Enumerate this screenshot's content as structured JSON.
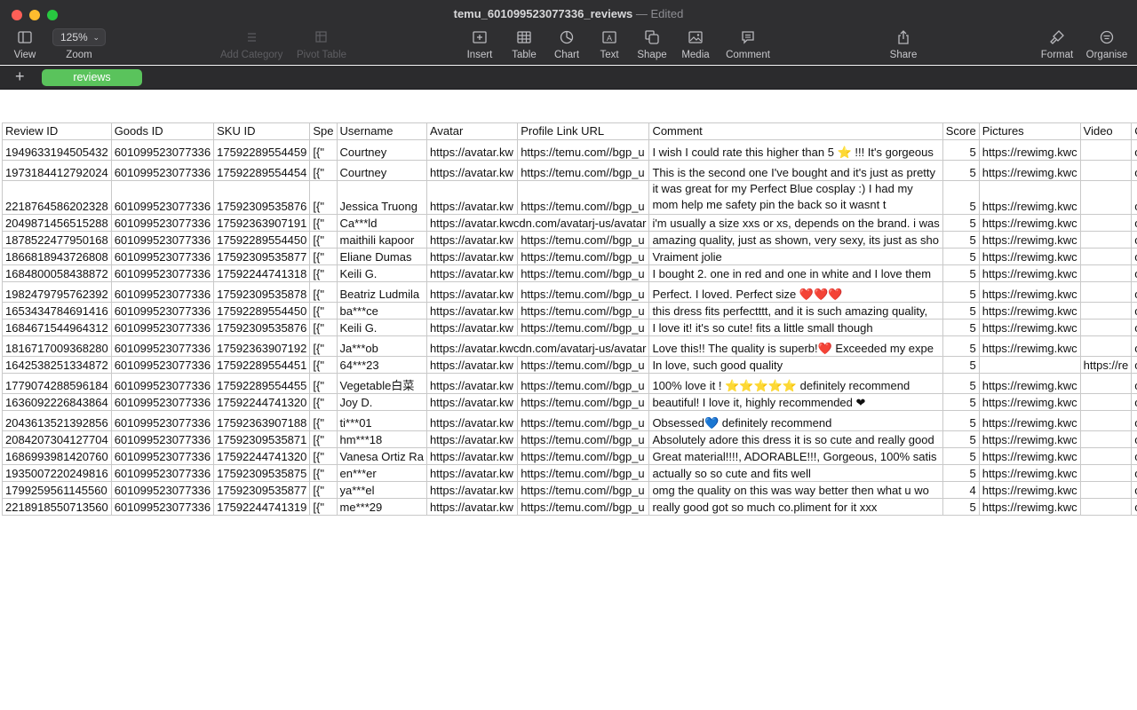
{
  "window": {
    "filename": "temu_601099523077336_reviews",
    "separator": " — ",
    "status": "Edited"
  },
  "toolbar": {
    "view": "View",
    "zoom_value": "125%",
    "zoom": "Zoom",
    "add_category": "Add Category",
    "pivot_table": "Pivot Table",
    "insert": "Insert",
    "table": "Table",
    "chart": "Chart",
    "text": "Text",
    "shape": "Shape",
    "media": "Media",
    "comment": "Comment",
    "share": "Share",
    "format": "Format",
    "organise": "Organise"
  },
  "tabs": {
    "add": "+",
    "sheet": "reviews"
  },
  "table": {
    "headers": [
      "Review ID",
      "Goods ID",
      "SKU ID",
      "Spe",
      "Username",
      "Avatar",
      "Profile Link URL",
      "Comment",
      "Score",
      "Pictures",
      "Video",
      "Crea"
    ],
    "rows": [
      {
        "id": "1949633194505432",
        "goods": "601099523077336",
        "sku": "17592289554459",
        "spec": "[{\"",
        "user": "Courtney",
        "avatar": "https://avatar.kw",
        "profile": "https://temu.com//bgp_u",
        "comment": "I wish I could rate this higher than 5 ⭐ !!! It's gorgeous",
        "score": "5",
        "pictures": "https://rewimg.kwc",
        "video": "",
        "created": "on"
      },
      {
        "id": "1973184412792024",
        "goods": "601099523077336",
        "sku": "17592289554454",
        "spec": "[{\"",
        "user": "Courtney",
        "avatar": "https://avatar.kw",
        "profile": "https://temu.com//bgp_u",
        "comment": "This is the second one I've bought and it's just as pretty",
        "score": "5",
        "pictures": "https://rewimg.kwc",
        "video": "",
        "created": "on"
      },
      {
        "id": "2218764586202328",
        "goods": "601099523077336",
        "sku": "17592309535876",
        "spec": "[{\"",
        "user": "Jessica Truong",
        "avatar": "https://avatar.kw",
        "profile": "https://temu.com//bgp_u",
        "comment": "it was great for my Perfect Blue cosplay :) I had my mom help me safety pin the back so it wasnt t",
        "score": "5",
        "pictures": "https://rewimg.kwc",
        "video": "",
        "created": "on"
      },
      {
        "id": "2049871456515288",
        "goods": "601099523077336",
        "sku": "17592363907191",
        "spec": "[{\"",
        "user": "Ca***ld",
        "avatar": "https://avatar.kwcdn.com/avatarj-us/avatar",
        "profile": "",
        "comment": "i'm usually a size xxs or xs, depends on the brand. i was",
        "score": "5",
        "pictures": "https://rewimg.kwc",
        "video": "",
        "created": "on"
      },
      {
        "id": "1878522477950168",
        "goods": "601099523077336",
        "sku": "17592289554450",
        "spec": "[{\"",
        "user": "maithili kapoor",
        "avatar": "https://avatar.kw",
        "profile": "https://temu.com//bgp_u",
        "comment": "amazing quality, just as shown, very sexy, its just as sho",
        "score": "5",
        "pictures": "https://rewimg.kwc",
        "video": "",
        "created": "on"
      },
      {
        "id": "1866818943726808",
        "goods": "601099523077336",
        "sku": "17592309535877",
        "spec": "[{\"",
        "user": "Eliane Dumas",
        "avatar": "https://avatar.kw",
        "profile": "https://temu.com//bgp_u",
        "comment": "Vraiment jolie",
        "score": "5",
        "pictures": "https://rewimg.kwc",
        "video": "",
        "created": "on"
      },
      {
        "id": "1684800058438872",
        "goods": "601099523077336",
        "sku": "17592244741318",
        "spec": "[{\"",
        "user": "Keili G.",
        "avatar": "https://avatar.kw",
        "profile": "https://temu.com//bgp_u",
        "comment": "I bought 2. one in red and one in white and I love them",
        "score": "5",
        "pictures": "https://rewimg.kwc",
        "video": "",
        "created": "on"
      },
      {
        "id": "1982479795762392",
        "goods": "601099523077336",
        "sku": "17592309535878",
        "spec": "[{\"",
        "user": "Beatriz Ludmila",
        "avatar": "https://avatar.kw",
        "profile": "https://temu.com//bgp_u",
        "comment": "Perfect. I loved. Perfect size ❤️❤️❤️",
        "score": "5",
        "pictures": "https://rewimg.kwc",
        "video": "",
        "created": "on"
      },
      {
        "id": "1653434784691416",
        "goods": "601099523077336",
        "sku": "17592289554450",
        "spec": "[{\"",
        "user": "ba***ce",
        "avatar": "https://avatar.kw",
        "profile": "https://temu.com//bgp_u",
        "comment": "this dress fits perfectttt, and it is such amazing quality,",
        "score": "5",
        "pictures": "https://rewimg.kwc",
        "video": "",
        "created": "on"
      },
      {
        "id": "1684671544964312",
        "goods": "601099523077336",
        "sku": "17592309535876",
        "spec": "[{\"",
        "user": "Keili G.",
        "avatar": "https://avatar.kw",
        "profile": "https://temu.com//bgp_u",
        "comment": "I love it! it's so cute! fits a little small though",
        "score": "5",
        "pictures": "https://rewimg.kwc",
        "video": "",
        "created": "on"
      },
      {
        "id": "1816717009368280",
        "goods": "601099523077336",
        "sku": "17592363907192",
        "spec": "[{\"",
        "user": "Ja***ob",
        "avatar": "https://avatar.kwcdn.com/avatarj-us/avatar",
        "profile": "",
        "comment": "Love this!! The quality is superb!❤️ Exceeded my expe",
        "score": "5",
        "pictures": "https://rewimg.kwc",
        "video": "",
        "created": "on"
      },
      {
        "id": "1642538251334872",
        "goods": "601099523077336",
        "sku": "17592289554451",
        "spec": "[{\"",
        "user": "64***23",
        "avatar": "https://avatar.kw",
        "profile": "https://temu.com//bgp_u",
        "comment": "In love, such good quality",
        "score": "5",
        "pictures": "",
        "video": "https://re",
        "created": "on"
      },
      {
        "id": "1779074288596184",
        "goods": "601099523077336",
        "sku": "17592289554455",
        "spec": "[{\"",
        "user": "Vegetable白菜",
        "avatar": "https://avatar.kw",
        "profile": "https://temu.com//bgp_u",
        "comment": "100% love it ! ⭐⭐⭐⭐⭐ definitely recommend",
        "score": "5",
        "pictures": "https://rewimg.kwc",
        "video": "",
        "created": "on"
      },
      {
        "id": "1636092226843864",
        "goods": "601099523077336",
        "sku": "17592244741320",
        "spec": "[{\"",
        "user": "Joy D.",
        "avatar": "https://avatar.kw",
        "profile": "https://temu.com//bgp_u",
        "comment": "beautiful! I love it, highly recommended ❤",
        "score": "5",
        "pictures": "https://rewimg.kwc",
        "video": "",
        "created": "on"
      },
      {
        "id": "2043613521392856",
        "goods": "601099523077336",
        "sku": "17592363907188",
        "spec": "[{\"",
        "user": "ti***01",
        "avatar": "https://avatar.kw",
        "profile": "https://temu.com//bgp_u",
        "comment": "Obsessed💙 definitely recommend",
        "score": "5",
        "pictures": "https://rewimg.kwc",
        "video": "",
        "created": "on"
      },
      {
        "id": "2084207304127704",
        "goods": "601099523077336",
        "sku": "17592309535871",
        "spec": "[{\"",
        "user": "hm***18",
        "avatar": "https://avatar.kw",
        "profile": "https://temu.com//bgp_u",
        "comment": "Absolutely adore this dress it is so cute and really good",
        "score": "5",
        "pictures": "https://rewimg.kwc",
        "video": "",
        "created": "on"
      },
      {
        "id": "1686993981420760",
        "goods": "601099523077336",
        "sku": "17592244741320",
        "spec": "[{\"",
        "user": "Vanesa Ortiz Ra",
        "avatar": "https://avatar.kw",
        "profile": "https://temu.com//bgp_u",
        "comment": "Great material!!!!, ADORABLE!!!, Gorgeous, 100% satis",
        "score": "5",
        "pictures": "https://rewimg.kwc",
        "video": "",
        "created": "on"
      },
      {
        "id": "1935007220249816",
        "goods": "601099523077336",
        "sku": "17592309535875",
        "spec": "[{\"",
        "user": "en***er",
        "avatar": "https://avatar.kw",
        "profile": "https://temu.com//bgp_u",
        "comment": "actually so so cute and fits well",
        "score": "5",
        "pictures": "https://rewimg.kwc",
        "video": "",
        "created": "on"
      },
      {
        "id": "1799259561145560",
        "goods": "601099523077336",
        "sku": "17592309535877",
        "spec": "[{\"",
        "user": "ya***el",
        "avatar": "https://avatar.kw",
        "profile": "https://temu.com//bgp_u",
        "comment": "omg the quality on this was way better then what u wo",
        "score": "4",
        "pictures": "https://rewimg.kwc",
        "video": "",
        "created": "on"
      },
      {
        "id": "2218918550713560",
        "goods": "601099523077336",
        "sku": "17592244741319",
        "spec": "[{\"",
        "user": "me***29",
        "avatar": "https://avatar.kw",
        "profile": "https://temu.com//bgp_u",
        "comment": "really good got so much co.pliment for it xxx",
        "score": "5",
        "pictures": "https://rewimg.kwc",
        "video": "",
        "created": "on"
      }
    ]
  }
}
